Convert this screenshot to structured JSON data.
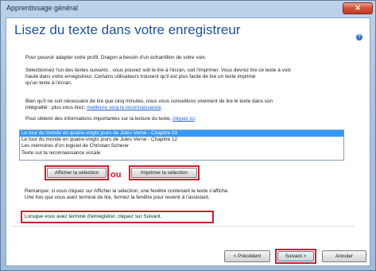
{
  "window": {
    "title": "Apprentissage général",
    "close_label": "✕"
  },
  "page": {
    "heading": "Lisez du texte dans votre enregistreur",
    "help_icon": "help-icon",
    "intro": "Pour pouvoir adapter votre profil, Dragon a besoin d'un échantillon de votre voix.",
    "select_line1": "Sélectionnez l'un des textes suivants ; vous pouvez soit le lire à l'écran, soit l'imprimer. Vous devrez lire ce texte à voix",
    "select_line2": "haute dans votre enregistreur. Certains utilisateurs trouvent qu'il est plus facile de lire un texte imprimé",
    "select_line3": "qu'un texte à l'écran.",
    "minutes_line1": "Bien qu'il ne soit nécessaire de lire que cinq minutes, nous vous conseillons vivement de lire le texte dans son",
    "minutes_line2_prefix": "intégralité : plus vous lirez, ",
    "minutes_link": "meilleure sera la reconnaissance",
    "minutes_line2_suffix": ".",
    "info_prefix": "Pour obtenir des informations importantes sur la lecture du texte, ",
    "info_link": "cliquez ici",
    "info_suffix": "."
  },
  "texts_list": {
    "items": [
      "Le tour du monde en quatre-vingts jours de Jules Verne - Chapitre 03",
      "Le tour du monde en quatre-vingts jours de Jules Verne - Chapitre 12",
      "Les mémoires d'un logiciel de Christian Scherer",
      "Texte sur la reconnaissance vocale"
    ],
    "selected_index": 0
  },
  "actions": {
    "show_label": "Afficher la sélection",
    "or_label": "ou",
    "print_label": "Imprimer la sélection"
  },
  "remarks": {
    "line1": "Remarque: si vous cliquez sur Afficher la sélection, une fenêtre contenant le texte s'affiche.",
    "line2": "Une fois que vous avez terminé de lire, fermez la fenêtre pour revenir à l'assistant.",
    "done": "Lorsque vous avez terminé d'enregistrer, cliquez sur Suivant."
  },
  "footer": {
    "previous_label": "< Précédent",
    "next_label": "Suivant >",
    "cancel_label": "Annuler"
  },
  "colors": {
    "heading": "#1e4f9c",
    "highlight": "#cc1f2a",
    "selection": "#3399ff",
    "link": "#1f5fd1"
  }
}
